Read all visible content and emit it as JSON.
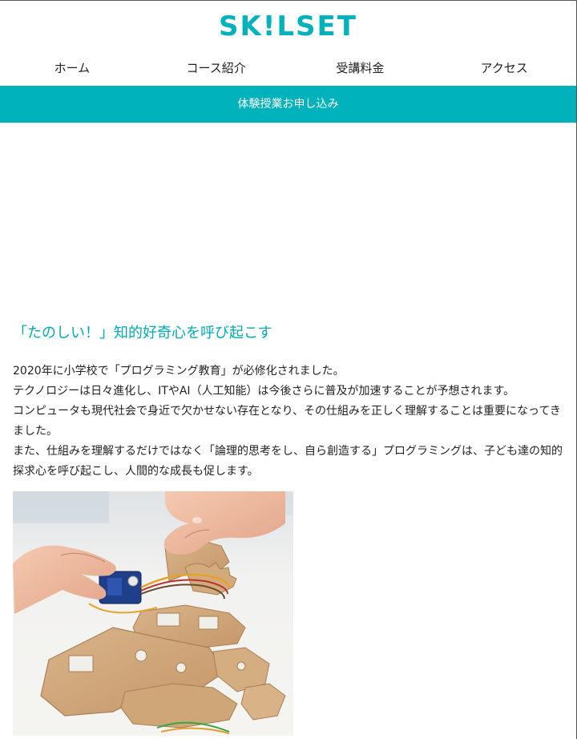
{
  "brand": {
    "logo_text": "SK!LSET",
    "color": "#00b2bc"
  },
  "nav": {
    "items": [
      {
        "label": "ホーム"
      },
      {
        "label": "コース紹介"
      },
      {
        "label": "受講料金"
      },
      {
        "label": "アクセス"
      }
    ]
  },
  "cta": {
    "label": "体験授業お申し込み",
    "color": "#00b2bc"
  },
  "section": {
    "title": "「たのしい！」知的好奇心を呼び起こす",
    "paragraphs": [
      "2020年に小学校で「プログラミング教育」が必修化されました。",
      "テクノロジーは日々進化し、ITやAI（人工知能）は今後さらに普及が加速することが予想されます。",
      "コンピュータも現代社会で身近で欠かせない存在となり、その仕組みを正しく理解することは重要になってきました。",
      "また、仕組みを理解するだけではなく「論理的思考をし、自ら創造する」プログラミングは、子ども達の知的探求心を呼び起こし、人間的な成長も促します。"
    ]
  },
  "photo": {
    "subject": "children-hands-assembling-cardboard-robot-kit-with-servo-motor"
  }
}
